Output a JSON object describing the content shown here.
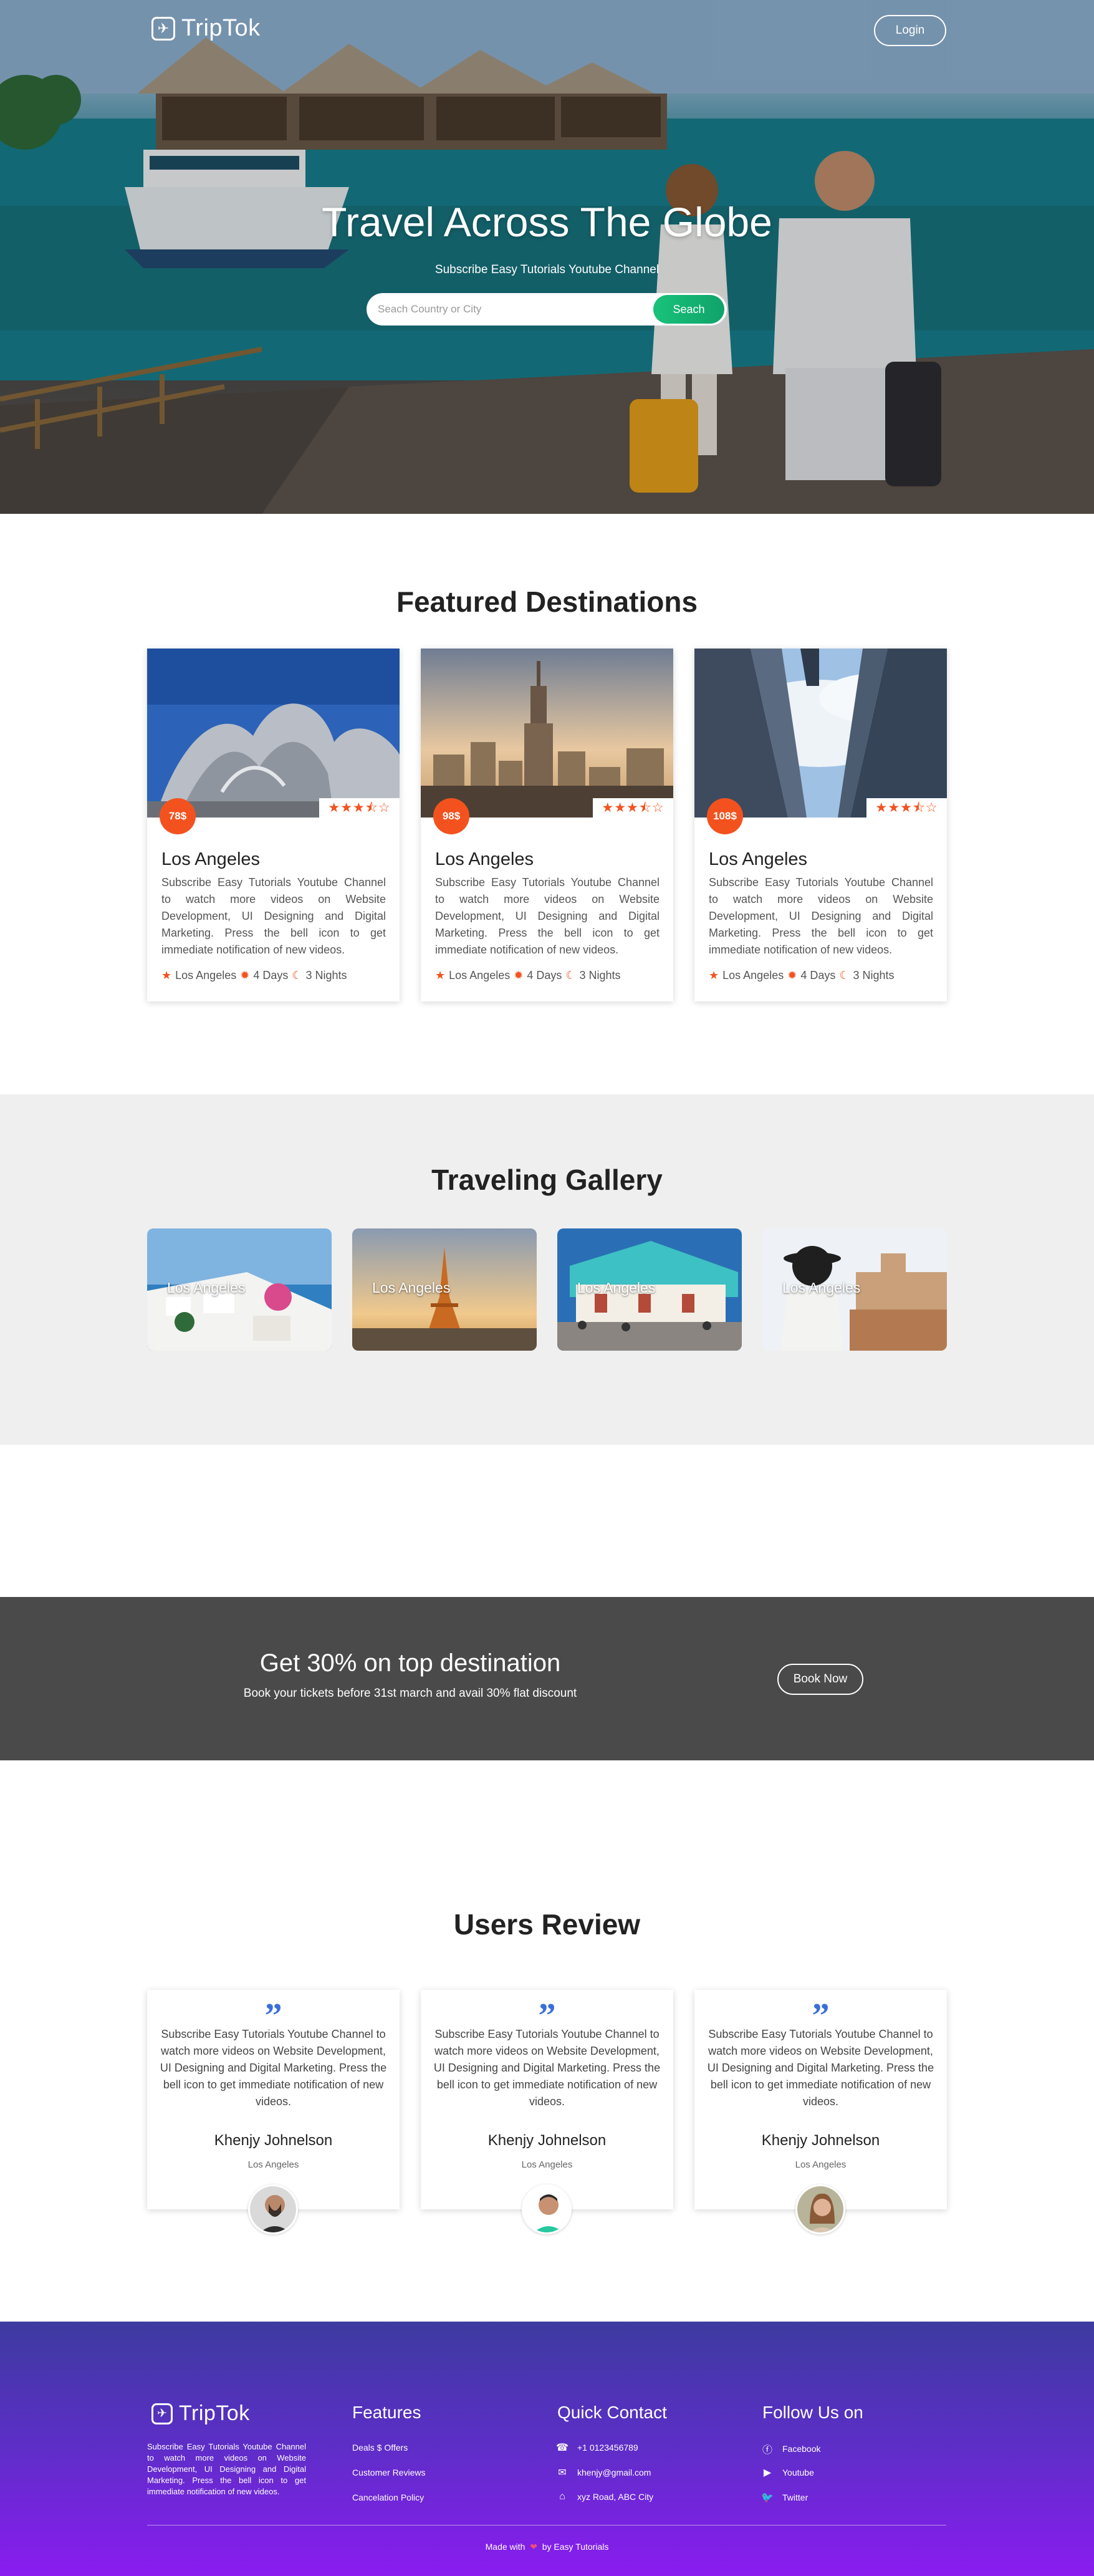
{
  "header": {
    "brand": "TripTok",
    "login_label": "Login",
    "hero_title": "Travel Across The Globe",
    "hero_subtitle": "Subscribe Easy Tutorials Youtube Channel",
    "search_placeholder": "Seach Country or City",
    "search_button": "Seach"
  },
  "featured": {
    "title": "Featured Destinations",
    "cards": [
      {
        "price": "78$",
        "rating": 3.5,
        "stars": "★★★⯪☆",
        "name": "Los Angeles",
        "desc": "Subscribe Easy Tutorials Youtube Channel to watch more videos on Website Development, UI Designing and Digital Marketing. Press the bell icon to get immediate notification of new videos.",
        "location": "Los Angeles",
        "days": "4 Days",
        "nights": "3 Nights"
      },
      {
        "price": "98$",
        "rating": 3.5,
        "stars": "★★★⯪☆",
        "name": "Los Angeles",
        "desc": "Subscribe Easy Tutorials Youtube Channel to watch more videos on Website Development, UI Designing and Digital Marketing. Press the bell icon to get immediate notification of new videos.",
        "location": "Los Angeles",
        "days": "4 Days",
        "nights": "3 Nights"
      },
      {
        "price": "108$",
        "rating": 3.5,
        "stars": "★★★⯪☆",
        "name": "Los Angeles",
        "desc": "Subscribe Easy Tutorials Youtube Channel to watch more videos on Website Development, UI Designing and Digital Marketing. Press the bell icon to get immediate notification of new videos.",
        "location": "Los Angeles",
        "days": "4 Days",
        "nights": "3 Nights"
      }
    ]
  },
  "gallery": {
    "title": "Traveling Gallery",
    "items": [
      {
        "label": "Los Angeles"
      },
      {
        "label": "Los Angeles"
      },
      {
        "label": "Los Angeles"
      },
      {
        "label": "Los Angeles"
      }
    ]
  },
  "offer": {
    "title": "Get 30% on top destination",
    "subtitle": "Book your tickets before 31st march and avail 30% flat discount",
    "button": "Book Now"
  },
  "reviews": {
    "title": "Users Review",
    "quote_mark": "”",
    "items": [
      {
        "text": "Subscribe Easy Tutorials Youtube Channel to watch more videos on Website Development, UI Designing and Digital Marketing. Press the bell icon to get immediate notification of new videos.",
        "name": "Khenjy Johnelson",
        "location": "Los Angeles"
      },
      {
        "text": "Subscribe Easy Tutorials Youtube Channel to watch more videos on Website Development, UI Designing and Digital Marketing. Press the bell icon to get immediate notification of new videos.",
        "name": "Khenjy Johnelson",
        "location": "Los Angeles"
      },
      {
        "text": "Subscribe Easy Tutorials Youtube Channel to watch more videos on Website Development, UI Designing and Digital Marketing. Press the bell icon to get immediate notification of new videos.",
        "name": "Khenjy Johnelson",
        "location": "Los Angeles"
      }
    ]
  },
  "footer": {
    "brand": "TripTok",
    "about": "Subscribe Easy Tutorials Youtube Channel to watch more videos on Website Development, UI Designing and Digital Marketing. Press the bell icon to get immediate notification of new videos.",
    "features_title": "Features",
    "features": [
      "Deals $ Offers",
      "Customer Reviews",
      "Cancelation Policy"
    ],
    "contact_title": "Quick Contact",
    "contacts": [
      {
        "icon": "phone-icon",
        "text": "+1 0123456789"
      },
      {
        "icon": "mail-icon",
        "text": "khenjy@gmail.com"
      },
      {
        "icon": "home-icon",
        "text": "xyz Road, ABC City"
      }
    ],
    "follow_title": "Follow Us on",
    "social": [
      {
        "icon": "facebook-icon",
        "text": "Facebook"
      },
      {
        "icon": "youtube-icon",
        "text": "Youtube"
      },
      {
        "icon": "twitter-icon",
        "text": "Twitter"
      }
    ],
    "made_prefix": "Made with",
    "made_suffix": "by Easy Tutorials"
  },
  "colors": {
    "accent": "#f3521f",
    "search_button": "#18c27a",
    "quote": "#3a6fd8",
    "offer_bg": "#4a4a4a",
    "gallery_bg": "#efefef"
  }
}
